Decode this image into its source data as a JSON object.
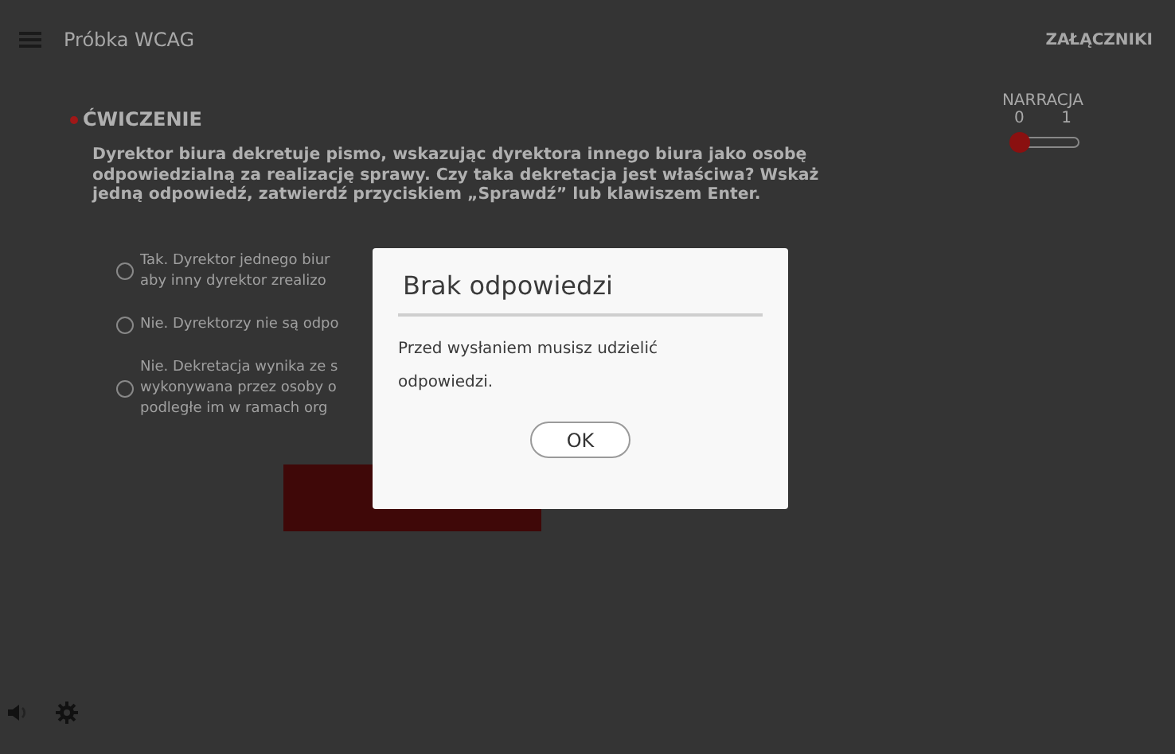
{
  "header": {
    "title": "Próbka WCAG",
    "attachments": "ZAŁĄCZNIKI"
  },
  "narration": {
    "label": "NARRACJA",
    "min": "0",
    "max": "1",
    "level": 0
  },
  "exercise": {
    "heading": "ĆWICZENIE",
    "question": "Dyrektor biura dekretuje pismo, wskazując dyrektora innego biura jako osobę odpowiedzialną za realizację sprawy. Czy taka dekretacja jest właściwa? Wskaż jedną odpowiedź, zatwierdź przyciskiem „Sprawdź” lub klawiszem Enter.",
    "options": [
      {
        "lines": [
          "Tak. Dyrektor jednego biur",
          "aby inny dyrektor zrealizo"
        ],
        "selected": false
      },
      {
        "lines": [
          "Nie. Dyrektorzy nie są odpo"
        ],
        "selected": false
      },
      {
        "lines": [
          "Nie. Dekretacja wynika ze s",
          "wykonywana przez osoby o",
          "podległe im w ramach org"
        ],
        "selected": false
      }
    ]
  },
  "dialog": {
    "title": "Brak odpowiedzi",
    "message": "Przed wysłaniem musisz udzielić odpowiedzi.",
    "button": "OK"
  }
}
